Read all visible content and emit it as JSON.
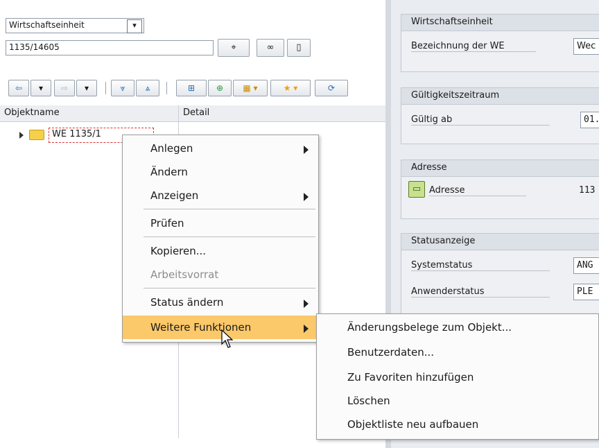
{
  "left": {
    "select_value": "Wirtschaftseinheit",
    "input_value": "1135/14605",
    "columns": {
      "name": "Objektname",
      "detail": "Detail"
    },
    "tree_node": "WE 1135/1"
  },
  "context_menu": {
    "items": [
      {
        "label": "Anlegen",
        "submenu": true
      },
      {
        "label": "Ändern"
      },
      {
        "label": "Anzeigen",
        "submenu": true
      },
      {
        "label": "Prüfen"
      },
      {
        "label": "Kopieren..."
      },
      {
        "label": "Arbeitsvorrat",
        "disabled": true
      },
      {
        "label": "Status ändern",
        "submenu": true
      },
      {
        "label": "Weitere Funktionen",
        "submenu": true,
        "highlighted": true
      }
    ]
  },
  "submenu": {
    "items": [
      "Änderungsbelege zum Objekt...",
      "Benutzerdaten...",
      "Zu Favoriten hinzufügen",
      "Löschen",
      "Objektliste neu aufbauen"
    ]
  },
  "right": {
    "g1": {
      "title": "Wirtschaftseinheit",
      "label": "Bezeichnung der WE",
      "value": "Wec"
    },
    "g2": {
      "title": "Gültigkeitszeitraum",
      "label": "Gültig ab",
      "value": "01."
    },
    "g3": {
      "title": "Adresse",
      "label": "Adresse",
      "value": "113"
    },
    "g4": {
      "title": "Statusanzeige",
      "label1": "Systemstatus",
      "value1": "ANG",
      "label2": "Anwenderstatus",
      "value2": "PLE"
    }
  },
  "colors": {
    "highlight": "#fbc86a",
    "folder": "#f5d04a",
    "focus_border": "#dd3333"
  }
}
